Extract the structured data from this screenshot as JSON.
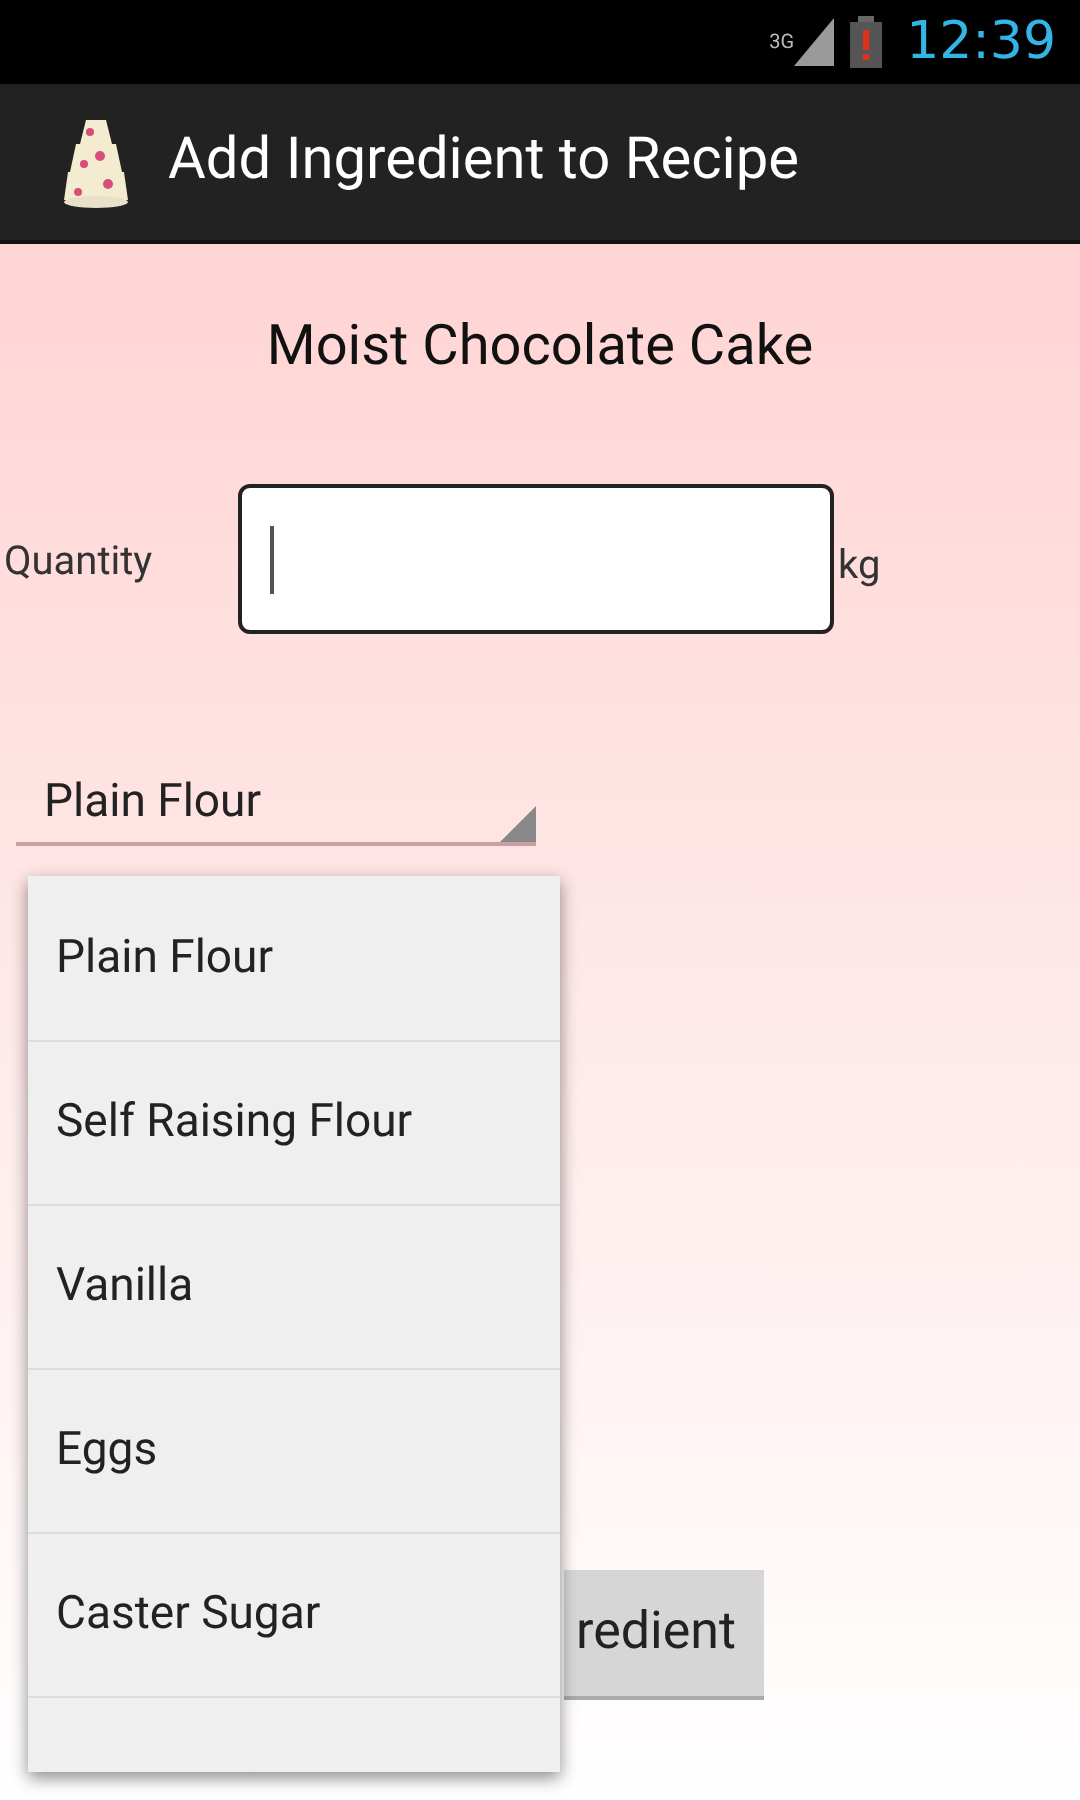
{
  "status_bar": {
    "network": "3G",
    "time": "12:39"
  },
  "action_bar": {
    "title": "Add Ingredient to Recipe"
  },
  "recipe_title": "Moist Chocolate Cake",
  "quantity": {
    "label": "Quantity",
    "unit": "kg"
  },
  "spinner": {
    "value": "Plain Flour",
    "expanded": true
  },
  "dropdown_items": [
    {
      "label": "Plain Flour"
    },
    {
      "label": "Self Raising Flour"
    },
    {
      "label": "Vanilla"
    },
    {
      "label": "Eggs"
    },
    {
      "label": "Caster Sugar"
    }
  ],
  "add_button": {
    "label": "redient"
  }
}
